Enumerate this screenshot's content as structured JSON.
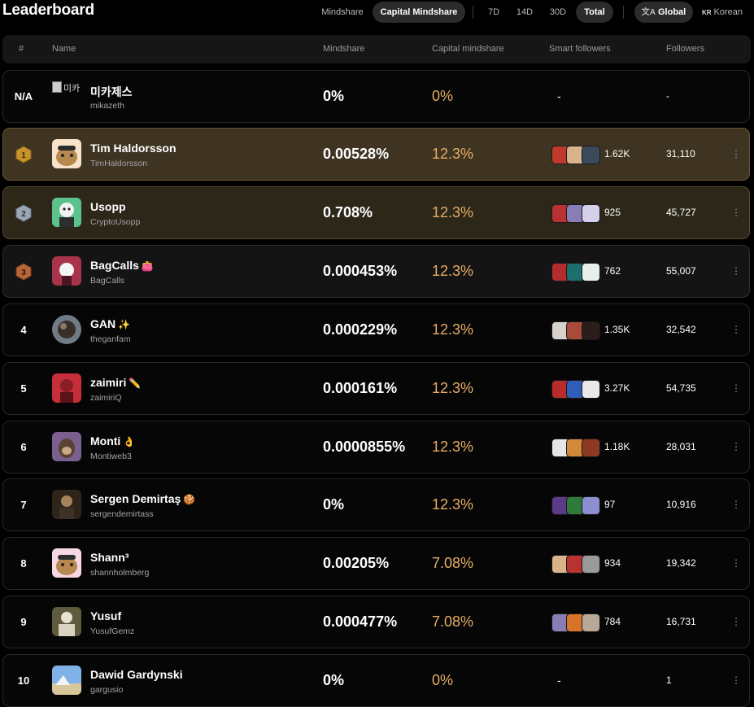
{
  "header": {
    "title": "Leaderboard",
    "controls": {
      "mindshare": "Mindshare",
      "capital_mindshare": "Capital Mindshare",
      "d7": "7D",
      "d14": "14D",
      "d30": "30D",
      "total": "Total",
      "global": "Global",
      "kr_prefix": "KR",
      "korean": "Korean"
    }
  },
  "columns": {
    "rank": "#",
    "name": "Name",
    "mindshare": "Mindshare",
    "capital": "Capital mindshare",
    "smart": "Smart followers",
    "followers": "Followers"
  },
  "colors": {
    "accent_orange": "#e6ad66",
    "gold_row": "#3f3422",
    "silver_row": "#2c2719"
  },
  "rows": [
    {
      "rank": "N/A",
      "name": "미카제스",
      "handle": "mikazeth",
      "emoji": "",
      "mindshare": "0%",
      "capital": "0%",
      "smart": "-",
      "followers": "-",
      "broken_alt": "미카"
    },
    {
      "rank": "1",
      "name": "Tim Haldorsson",
      "handle": "TimHaldorsson",
      "emoji": "",
      "mindshare": "0.00528%",
      "capital": "12.3%",
      "smart": "1.62K",
      "followers": "31,110"
    },
    {
      "rank": "2",
      "name": "Usopp",
      "handle": "CryptoUsopp",
      "emoji": "",
      "mindshare": "0.708%",
      "capital": "12.3%",
      "smart": "925",
      "followers": "45,727"
    },
    {
      "rank": "3",
      "name": "BagCalls",
      "handle": "BagCalls",
      "emoji": "👛",
      "mindshare": "0.000453%",
      "capital": "12.3%",
      "smart": "762",
      "followers": "55,007"
    },
    {
      "rank": "4",
      "name": "GAN",
      "handle": "theganfam",
      "emoji": "✨",
      "mindshare": "0.000229%",
      "capital": "12.3%",
      "smart": "1.35K",
      "followers": "32,542"
    },
    {
      "rank": "5",
      "name": "zaimiri",
      "handle": "zaimiriQ",
      "emoji": "✏️",
      "mindshare": "0.000161%",
      "capital": "12.3%",
      "smart": "3.27K",
      "followers": "54,735"
    },
    {
      "rank": "6",
      "name": "Monti",
      "handle": "Montiweb3",
      "emoji": "👌",
      "mindshare": "0.0000855%",
      "capital": "12.3%",
      "smart": "1.18K",
      "followers": "28,031"
    },
    {
      "rank": "7",
      "name": "Sergen Demirtaş",
      "handle": "sergendemirtass",
      "emoji": "🍪",
      "mindshare": "0%",
      "capital": "12.3%",
      "smart": "97",
      "followers": "10,916"
    },
    {
      "rank": "8",
      "name": "Shann³",
      "handle": "shannholmberg",
      "emoji": "",
      "mindshare": "0.00205%",
      "capital": "7.08%",
      "smart": "934",
      "followers": "19,342"
    },
    {
      "rank": "9",
      "name": "Yusuf",
      "handle": "YusufGemz",
      "emoji": "",
      "mindshare": "0.000477%",
      "capital": "7.08%",
      "smart": "784",
      "followers": "16,731"
    },
    {
      "rank": "10",
      "name": "Dawid Gardynski",
      "handle": "gargusio",
      "emoji": "",
      "mindshare": "0%",
      "capital": "0%",
      "smart": "-",
      "followers": "1"
    }
  ]
}
